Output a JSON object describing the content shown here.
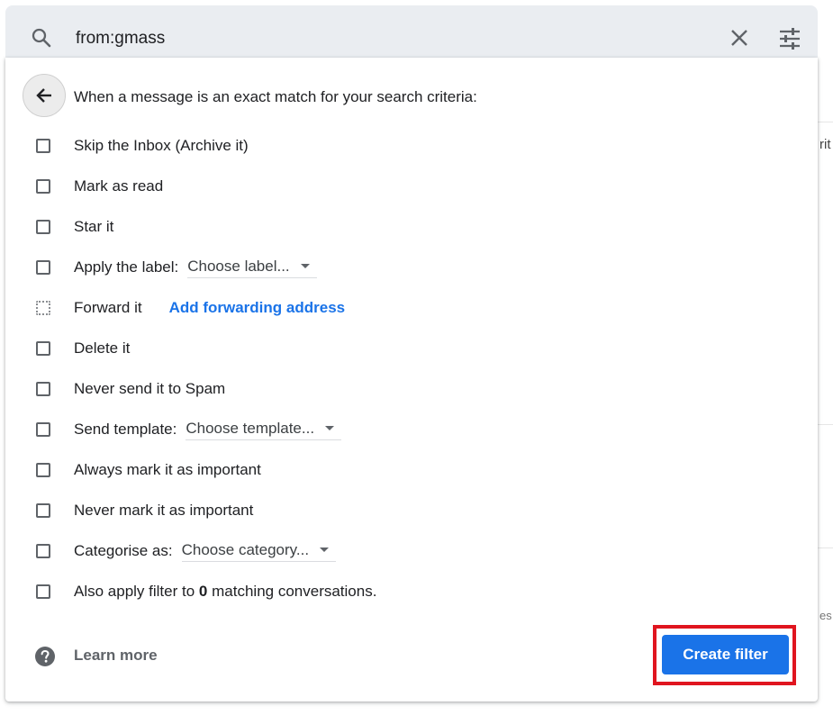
{
  "search": {
    "value": "from:gmass"
  },
  "panel": {
    "heading": "When a message is an exact match for your search criteria:",
    "options": [
      {
        "label": "Skip the Inbox (Archive it)"
      },
      {
        "label": "Mark as read"
      },
      {
        "label": "Star it"
      },
      {
        "label": "Apply the label:",
        "select": "Choose label..."
      },
      {
        "label": "Forward it",
        "link": "Add forwarding address"
      },
      {
        "label": "Delete it"
      },
      {
        "label": "Never send it to Spam"
      },
      {
        "label": "Send template:",
        "select": "Choose template..."
      },
      {
        "label": "Always mark it as important"
      },
      {
        "label": "Never mark it as important"
      },
      {
        "label": "Categorise as:",
        "select": "Choose category..."
      },
      {
        "label_prefix": "Also apply filter to",
        "count": "0",
        "label_suffix": "matching conversations."
      }
    ],
    "learn_more": "Learn more",
    "create_filter": "Create filter"
  },
  "background": {
    "partial_texts": [
      "rit",
      "es"
    ]
  },
  "colors": {
    "accent": "#1a73e8",
    "highlight": "#e0151f",
    "search_bar_bg": "#eaedf1"
  },
  "icons": [
    "search-icon",
    "close-icon",
    "tune-icon",
    "arrow-back-icon",
    "help-icon",
    "caret-down-icon"
  ]
}
